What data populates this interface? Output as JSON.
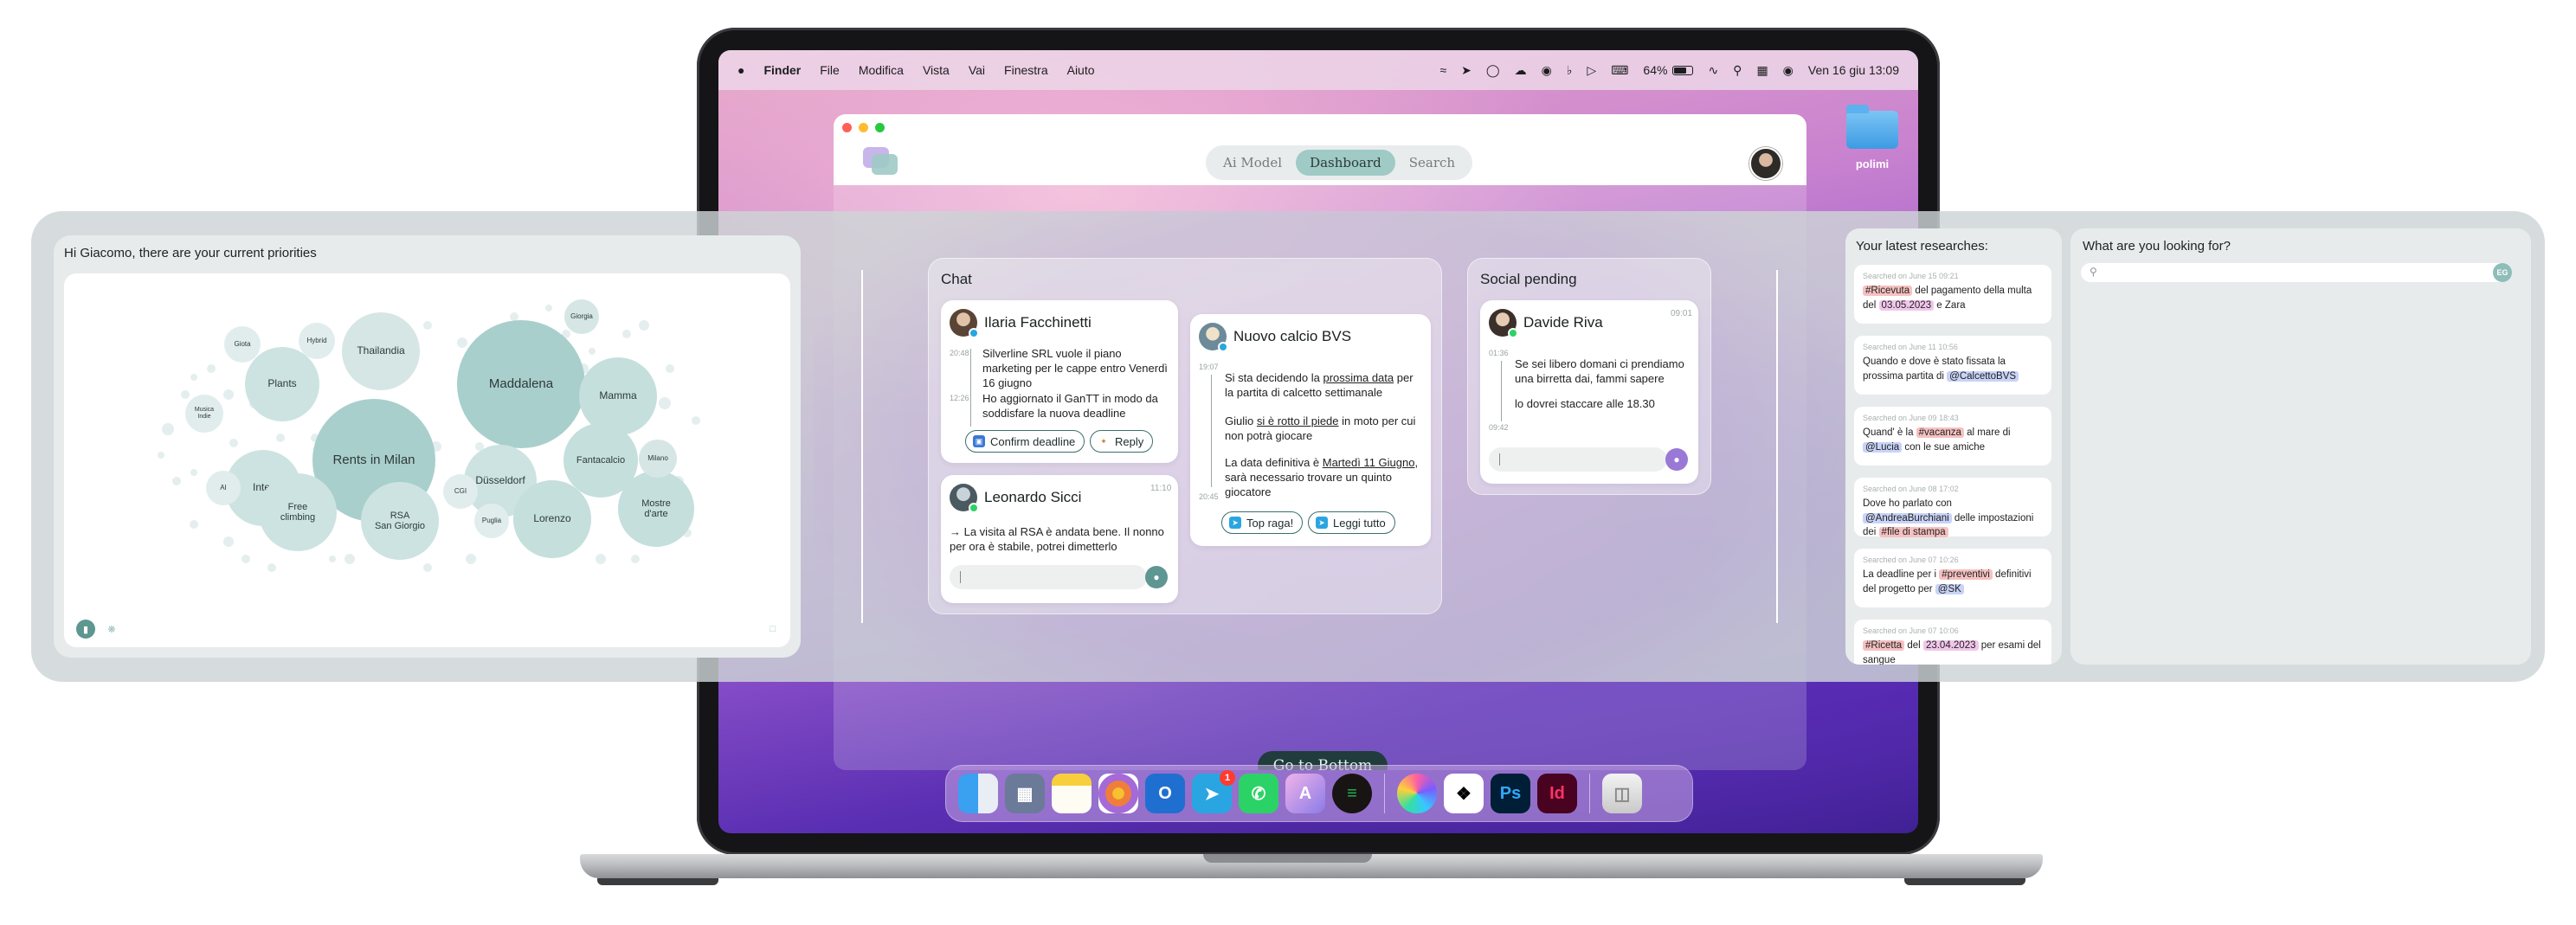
{
  "menubar": {
    "apple": "",
    "items": [
      "Finder",
      "File",
      "Modifica",
      "Vista",
      "Vai",
      "Finestra",
      "Aiuto"
    ],
    "battery": "64%",
    "datetime": "Ven 16 giu  13:09"
  },
  "desktop": {
    "folder_label": "polimi"
  },
  "app": {
    "tabs": [
      "Ai Model",
      "Dashboard",
      "Search"
    ],
    "active_tab": "Dashboard",
    "go_to_bottom": "Go to Bottom"
  },
  "priorities": {
    "title": "Hi Giacomo, there are your current priorities",
    "bubbles": [
      "Maddalena",
      "Rents in Milan",
      "Thailandia",
      "Mamma",
      "Plants",
      "Inter",
      "Fantacalcio",
      "Düsseldorf",
      "Free\nclimbing",
      "RSA\nSan Giorgio",
      "Lorenzo",
      "Mostre\nd'arte",
      "Milano",
      "Giorgia",
      "Giota",
      "Hybrid",
      "Musica\nIndie",
      "AI",
      "CGI",
      "Puglia"
    ]
  },
  "chat": {
    "title": "Chat",
    "ilaria": {
      "name": "Ilaria Facchinetti",
      "t1": "20:48",
      "m1": "Silverline SRL vuole il piano marketing per le cappe entro Venerdì 16 giugno",
      "t2": "12:26",
      "m2": "Ho aggiornato il GanTT in modo da soddisfare la nuova deadline",
      "btn_confirm": "Confirm deadline",
      "btn_reply": "Reply"
    },
    "leonardo": {
      "name": "Leonardo Sicci",
      "time": "11:10",
      "m1": "→ La visita al RSA è andata bene. Il nonno per ora è stabile, potrei dimetterlo"
    },
    "calcio": {
      "name": "Nuovo calcio BVS",
      "t0": "19:07",
      "m1a": "Si sta decidendo la ",
      "m1b": "prossima data",
      "m1c": " per la partita di calcetto settimanale",
      "m2a": "Giulio ",
      "m2b": "si è rotto il piede",
      "m2c": " in moto per cui non potrà giocare",
      "m3a": "La data definitiva è ",
      "m3b": "Martedì 11 Giugno",
      "m3c": ", sarà necessario trovare un quinto giocatore",
      "t_end": "20:45",
      "btn_top": "Top raga!",
      "btn_read": "Leggi tutto"
    }
  },
  "social": {
    "title": "Social pending",
    "name": "Davide Riva",
    "time": "09:01",
    "t1": "01:36",
    "m1": "Se sei libero domani ci prendiamo una birretta dai, fammi sapere",
    "m2": "lo dovrei staccare alle 18.30",
    "t2": "09:42"
  },
  "researches": {
    "title": "Your latest researches:",
    "items": [
      {
        "meta": "Searched on June 15 09:21",
        "a": "",
        "tag1": "#Ricevuta",
        "b": " del pagamento della multa del ",
        "tag2": "03.05.2023",
        "c": " e Zara"
      },
      {
        "meta": "Searched on June 11 10:56",
        "a": "Quando e dove è stato fissata la prossima partita di ",
        "tag1": "@CalcettoBVS",
        "b": "",
        "tag2": "",
        "c": ""
      },
      {
        "meta": "Searched on June 09 18:43",
        "a": "Quand' è la ",
        "tag1": "#vacanza",
        "b": " al mare di ",
        "tag2": "@Lucia",
        "c": " con le sue amiche"
      },
      {
        "meta": "Searched on June 08 17:02",
        "a": "Dove ho parlato con ",
        "tag1": "@AndreaBurchiani",
        "b": " delle impostazioni dei ",
        "tag2": "#file di stampa",
        "c": ""
      },
      {
        "meta": "Searched on June 07 10:26",
        "a": "La deadline per i ",
        "tag1": "#preventivi",
        "b": " definitivi del progetto per ",
        "tag2": "@SK",
        "c": ""
      },
      {
        "meta": "Searched on June 07 10:06",
        "a": "",
        "tag1": "#Ricetta",
        "b": " del ",
        "tag2": "23.04.2023",
        "c": " per esami del sangue"
      }
    ]
  },
  "search": {
    "title": "What are you looking for?",
    "placeholder": "",
    "button": "EG"
  },
  "colors": {
    "accent_teal": "#9fcac6",
    "dark_teal": "#203c3c",
    "mic_purple": "#9a78d6",
    "mic_teal": "#5e9691"
  }
}
